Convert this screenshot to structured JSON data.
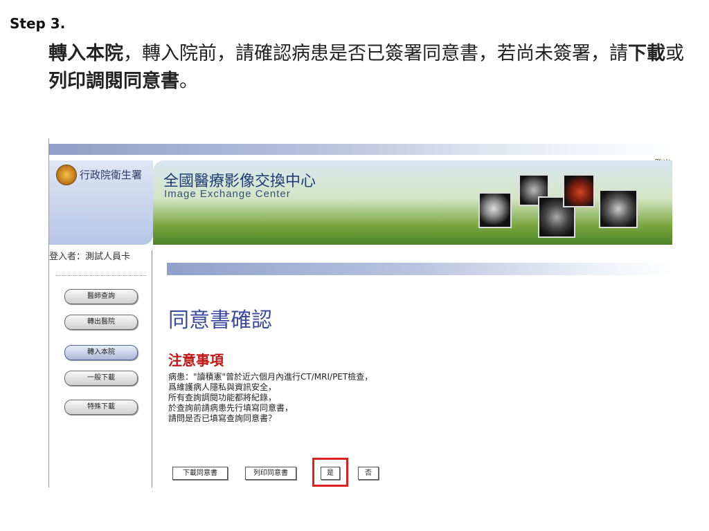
{
  "step": {
    "title": "Step 3."
  },
  "instruction": {
    "p1_bold": "轉入本院",
    "p2": "，轉入院前，請確認病患是否已簽署同意書，若尚未簽署，請",
    "p3_bold": "下載",
    "p4": "或",
    "p5_bold": "列印調閱同意書",
    "p6": "。"
  },
  "app": {
    "logout_label": "登出",
    "org_name": "行政院衛生署",
    "banner_title": "全國醫療影像交換中心",
    "banner_subtitle": "Image Exchange Center"
  },
  "sidebar": {
    "user_label": "登入者：測試人員卡",
    "items": [
      {
        "label": "醫師查詢"
      },
      {
        "label": "轉出醫院"
      },
      {
        "label": "轉入本院",
        "active": true
      },
      {
        "label": "一般下載"
      },
      {
        "label": "特殊下載"
      }
    ]
  },
  "main": {
    "heading": "同意書確認",
    "notice_heading": "注意事項",
    "notice_lines": [
      "病患：\"讀積憲\"曾於近六個月內進行CT/MRI/PET檢查，",
      "爲維護病人隱私與資訊安全，",
      "所有查詢調閱功能都將紀錄，",
      "於查詢前請病患先行填寫同意書，",
      "請問是否已填寫查詢同意書？"
    ],
    "buttons": {
      "download": "下載同意書",
      "print": "列印同意書",
      "yes": "是",
      "no": "否"
    }
  },
  "colors": {
    "highlight": "#e02020",
    "heading": "#3a4aa0",
    "notice": "#c01515"
  }
}
